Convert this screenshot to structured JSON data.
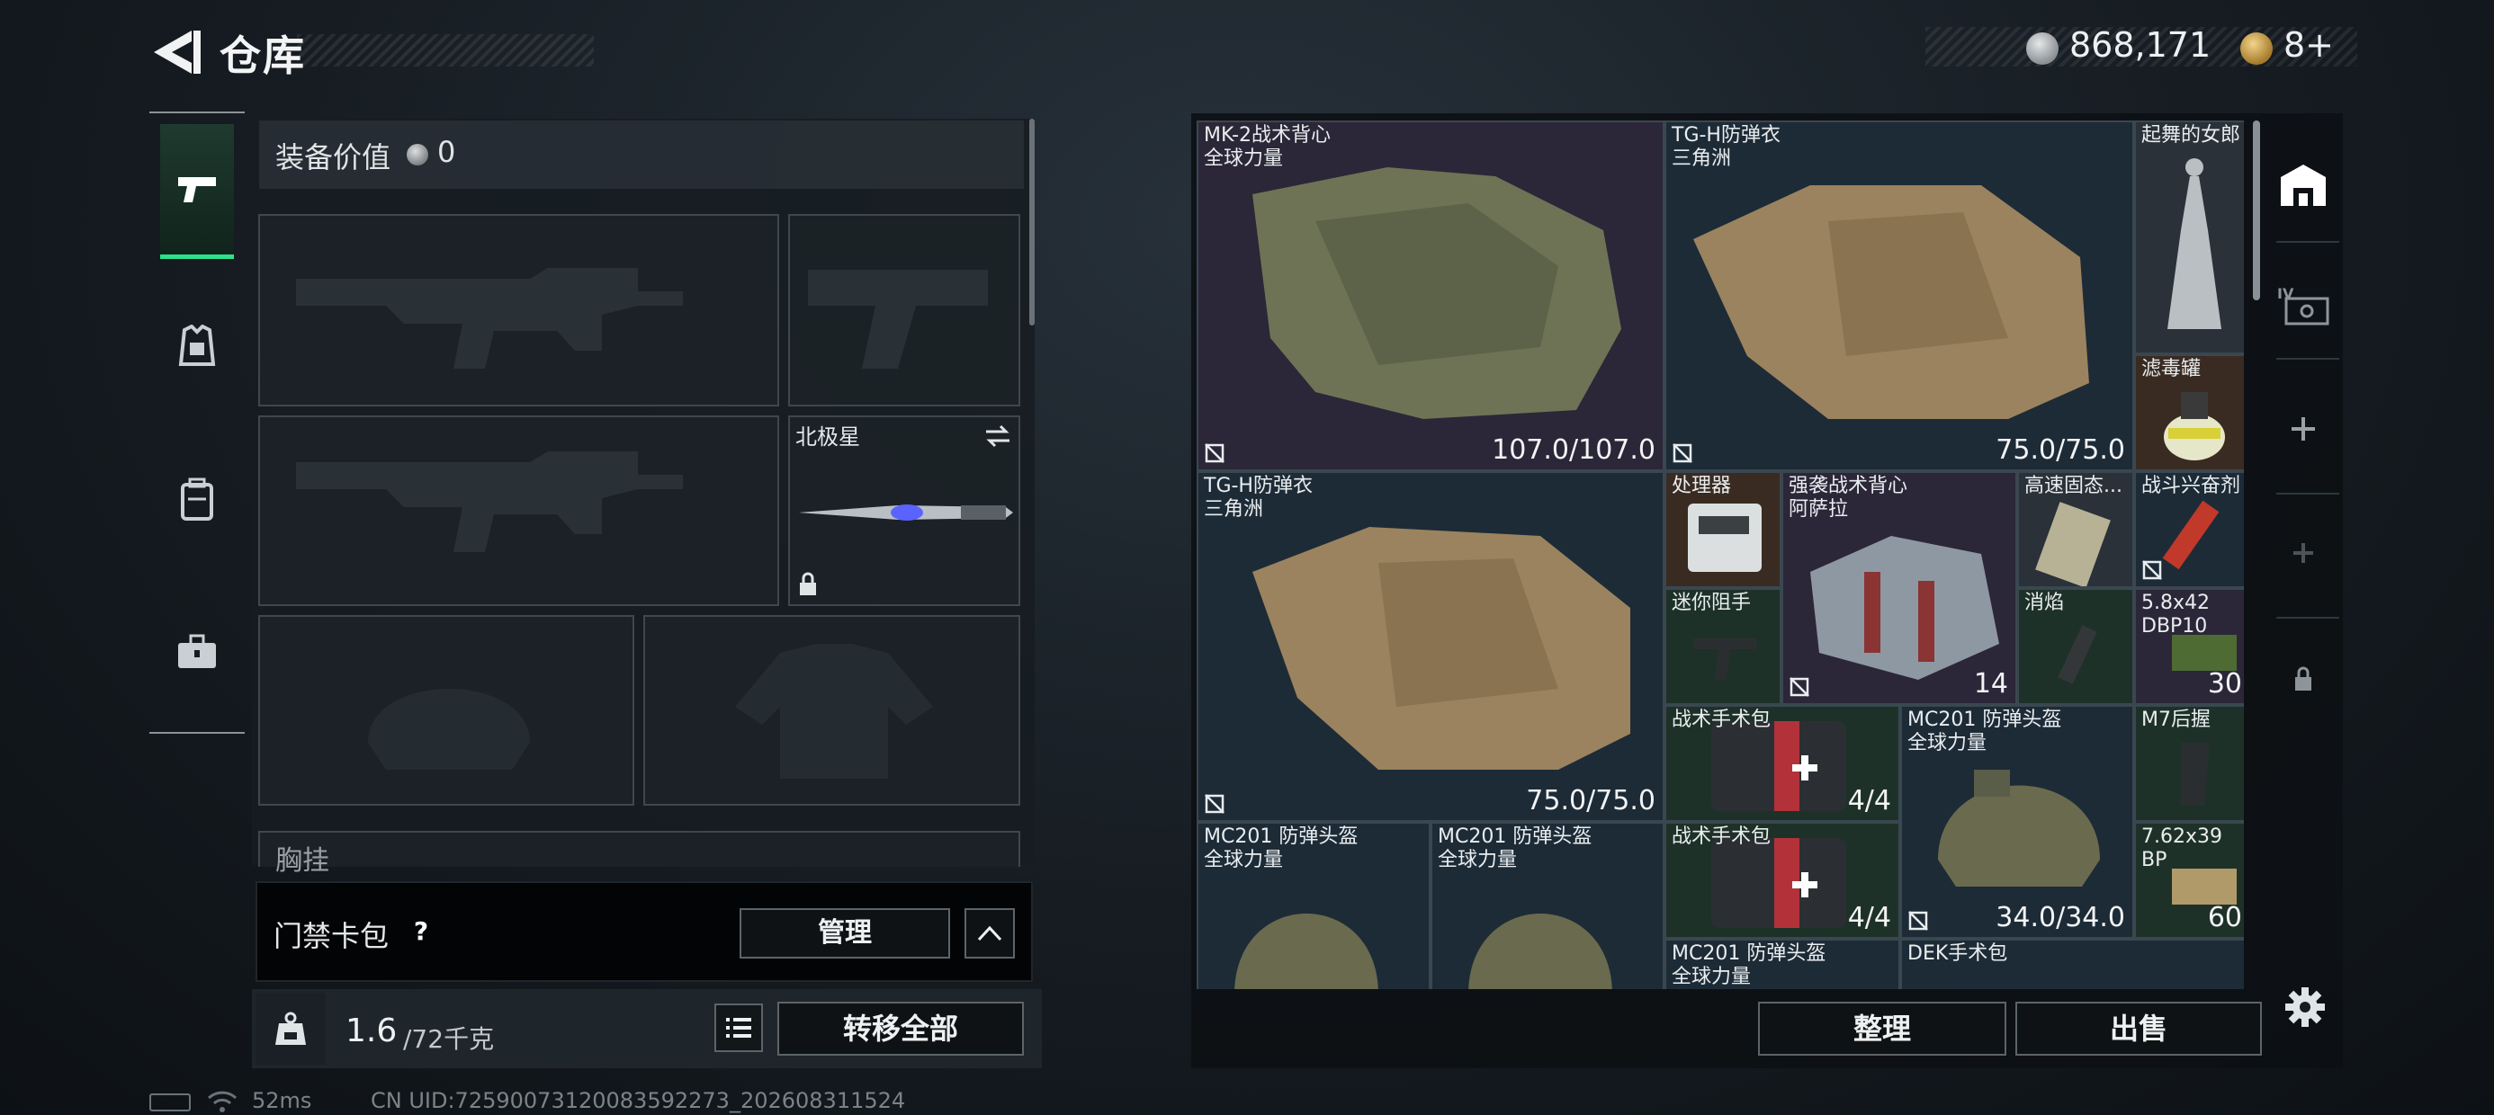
{
  "header": {
    "title": "仓库"
  },
  "currency": {
    "coins": "868,171",
    "tickets": "8+"
  },
  "equipment": {
    "value_label": "装备价值",
    "value": "0",
    "melee_name": "北极星",
    "chest_label": "胸挂"
  },
  "keycard": {
    "label": "门禁卡包",
    "help": "?",
    "manage_label": "管理"
  },
  "weight": {
    "current": "1.6",
    "max": "/72千克",
    "transfer_label": "转移全部"
  },
  "status": {
    "ping": "52ms",
    "uid": "CN UID:725900731200835922​73_202608311524"
  },
  "stash": {
    "items": [
      {
        "name": "MK-2战术背心",
        "sub": "全球力量",
        "value": "107.0/107.0",
        "icon": "no-trade-icon"
      },
      {
        "name": "TG-H防弹衣",
        "sub": "三角洲",
        "value": "75.0/75.0",
        "icon": "no-trade-icon"
      },
      {
        "name": "起舞的女郎",
        "sub": "",
        "value": ""
      },
      {
        "name": "滤毒罐",
        "sub": "",
        "value": ""
      },
      {
        "name": "TG-H防弹衣",
        "sub": "三角洲",
        "value": "75.0/75.0",
        "icon": "no-trade-icon"
      },
      {
        "name": "处理器",
        "sub": "",
        "value": ""
      },
      {
        "name": "强袭战术背心",
        "sub": "阿萨拉",
        "value": "14",
        "icon": "no-trade-icon"
      },
      {
        "name": "高速固态...",
        "sub": "",
        "value": ""
      },
      {
        "name": "战斗兴奋剂",
        "sub": "",
        "value": "",
        "icon": "no-trade-icon"
      },
      {
        "name": "迷你阻手",
        "sub": "",
        "value": ""
      },
      {
        "name": "消焰",
        "sub": "",
        "value": ""
      },
      {
        "name": "5.8x42",
        "sub": "DBP10",
        "value": "30"
      },
      {
        "name": "战术手术包",
        "sub": "",
        "value": "4/4"
      },
      {
        "name": "MC201 防弹头盔",
        "sub": "全球力量",
        "value": "34.0/34.0",
        "icon": "no-trade-icon"
      },
      {
        "name": "M7后握",
        "sub": "",
        "value": ""
      },
      {
        "name": "MC201 防弹头盔",
        "sub": "全球力量",
        "value": ""
      },
      {
        "name": "MC201 防弹头盔",
        "sub": "全球力量",
        "value": ""
      },
      {
        "name": "战术手术包",
        "sub": "",
        "value": "4/4"
      },
      {
        "name": "7.62x39",
        "sub": "BP",
        "value": "60"
      },
      {
        "name": "MC201 防弹头盔",
        "sub": "全球力量",
        "value": ""
      },
      {
        "name": "DEK手术包",
        "sub": "",
        "value": ""
      }
    ],
    "sort_label": "整理",
    "sell_label": "出售"
  },
  "colors": {
    "accent": "#2de08a",
    "panel": "#1a242c"
  }
}
